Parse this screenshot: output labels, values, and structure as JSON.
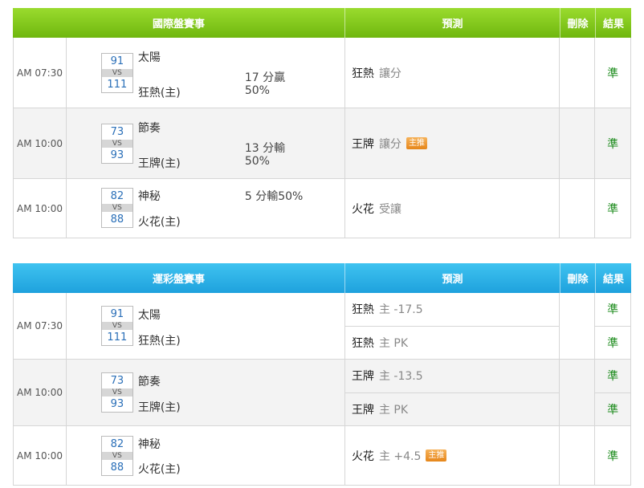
{
  "international": {
    "headers": {
      "event": "國際盤賽事",
      "prediction": "預測",
      "delete": "刪除",
      "result": "結果"
    },
    "rows": [
      {
        "time": "AM 07:30",
        "away_score": "91",
        "vs": "VS",
        "home_score": "111",
        "away": "太陽",
        "home": "狂熱(主)",
        "odds1": "17 分贏",
        "odds2": "50%",
        "pick": "狂熱",
        "pick_desc": "讓分",
        "badge": "",
        "result": "準"
      },
      {
        "time": "AM 10:00",
        "away_score": "73",
        "vs": "VS",
        "home_score": "93",
        "away": "節奏",
        "home": "王牌(主)",
        "odds1": "13 分輸",
        "odds2": "50%",
        "pick": "王牌",
        "pick_desc": "讓分",
        "badge": "主推",
        "result": "準"
      },
      {
        "time": "AM 10:00",
        "away_score": "82",
        "vs": "VS",
        "home_score": "88",
        "away": "神秘",
        "home": "火花(主)",
        "odds1": "5 分輸50%",
        "odds2": "",
        "pick": "火花",
        "pick_desc": "受讓",
        "badge": "",
        "result": "準"
      }
    ]
  },
  "lottery": {
    "headers": {
      "event": "運彩盤賽事",
      "prediction": "預測",
      "delete": "刪除",
      "result": "結果"
    },
    "rows": [
      {
        "time": "AM 07:30",
        "away_score": "91",
        "vs": "VS",
        "home_score": "111",
        "away": "太陽",
        "home": "狂熱(主)",
        "picks": [
          {
            "name": "狂熱",
            "desc": "主 -17.5",
            "badge": "",
            "result": "準"
          },
          {
            "name": "狂熱",
            "desc": "主 PK",
            "badge": "",
            "result": "準"
          }
        ]
      },
      {
        "time": "AM 10:00",
        "away_score": "73",
        "vs": "VS",
        "home_score": "93",
        "away": "節奏",
        "home": "王牌(主)",
        "picks": [
          {
            "name": "王牌",
            "desc": "主 -13.5",
            "badge": "",
            "result": "準"
          },
          {
            "name": "王牌",
            "desc": "主 PK",
            "badge": "",
            "result": "準"
          }
        ]
      },
      {
        "time": "AM 10:00",
        "away_score": "82",
        "vs": "VS",
        "home_score": "88",
        "away": "神秘",
        "home": "火花(主)",
        "picks": [
          {
            "name": "火花",
            "desc": "主 +4.5",
            "badge": "主推",
            "result": "準"
          }
        ]
      }
    ]
  }
}
